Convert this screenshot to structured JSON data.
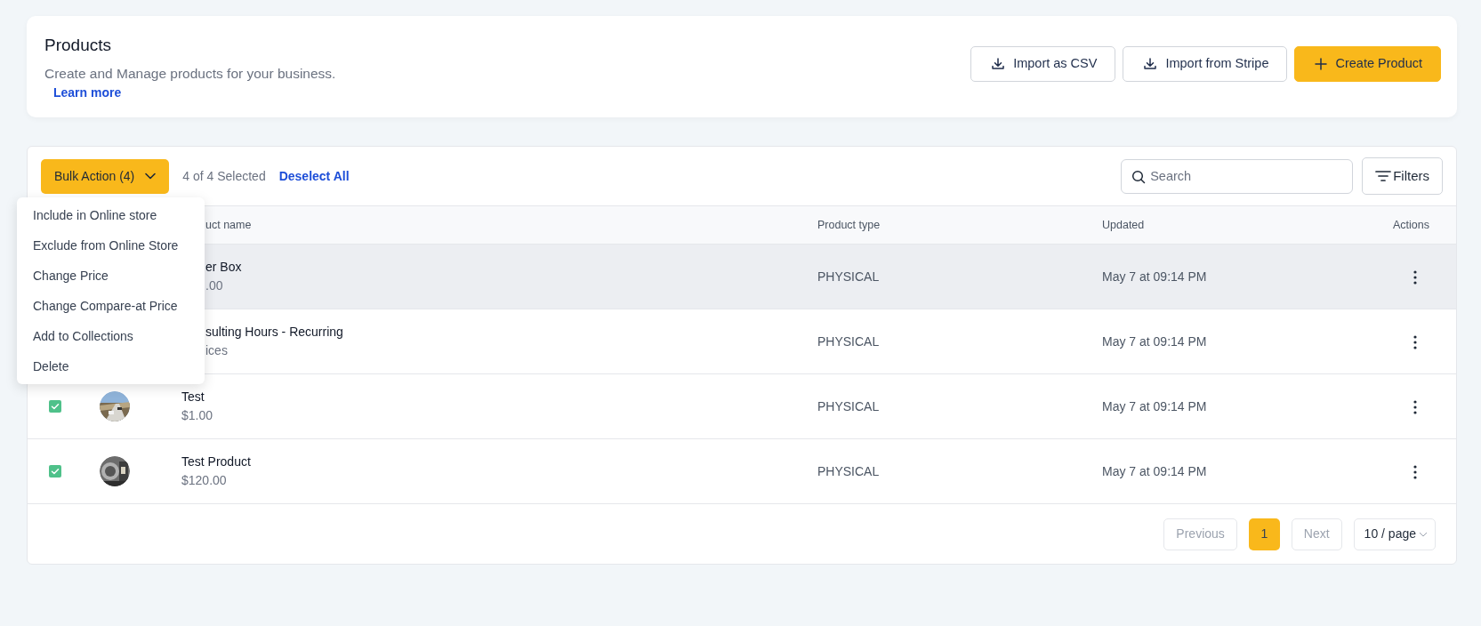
{
  "header": {
    "title": "Products",
    "subtitle": "Create and Manage products for your business.",
    "link": "Learn more",
    "buttons": [
      {
        "kind": "import",
        "label": "Import as CSV"
      },
      {
        "kind": "import",
        "label": "Import from Stripe"
      },
      {
        "kind": "create",
        "label": "Create Product"
      }
    ]
  },
  "toolbar": {
    "bulk_action": "Bulk Action (4)",
    "selection": "4 of 4 Selected",
    "deselect": "Deselect All",
    "search": {
      "placeholder": "Search"
    },
    "filters": "Filters"
  },
  "bulk_menu": [
    "Include in Online store",
    "Exclude from Online Store",
    "Change Price",
    "Change Compare-at Price",
    "Add to Collections",
    "Delete"
  ],
  "table": {
    "columns": [
      {
        "label": "uct name",
        "covered": true
      },
      {
        "label": "Product type"
      },
      {
        "label": "Updated"
      },
      {
        "label": "Actions"
      }
    ],
    "rows": [
      {
        "covered": true,
        "hovered": true,
        "name": "er Box",
        "price": ".00",
        "type": "PHYSICAL",
        "updated": "May 7 at 09:14 PM"
      },
      {
        "covered": true,
        "hovered": false,
        "name": "sulting Hours - Recurring",
        "price": "ices",
        "type": "PHYSICAL",
        "updated": "May 7 at 09:14 PM"
      },
      {
        "covered": false,
        "hovered": false,
        "checked": true,
        "name": "Test",
        "price": "$1.00",
        "type": "PHYSICAL",
        "updated": "May 7 at 09:14 PM"
      },
      {
        "covered": false,
        "hovered": false,
        "checked": true,
        "name": "Test Product",
        "price": "$120.00",
        "type": "PHYSICAL",
        "updated": "May 7 at 09:14 PM"
      }
    ]
  },
  "pagination": {
    "previous": "Previous",
    "pages": [
      {
        "label": "1",
        "selected": true
      }
    ],
    "next": "Next",
    "page_size": "10 / page"
  }
}
